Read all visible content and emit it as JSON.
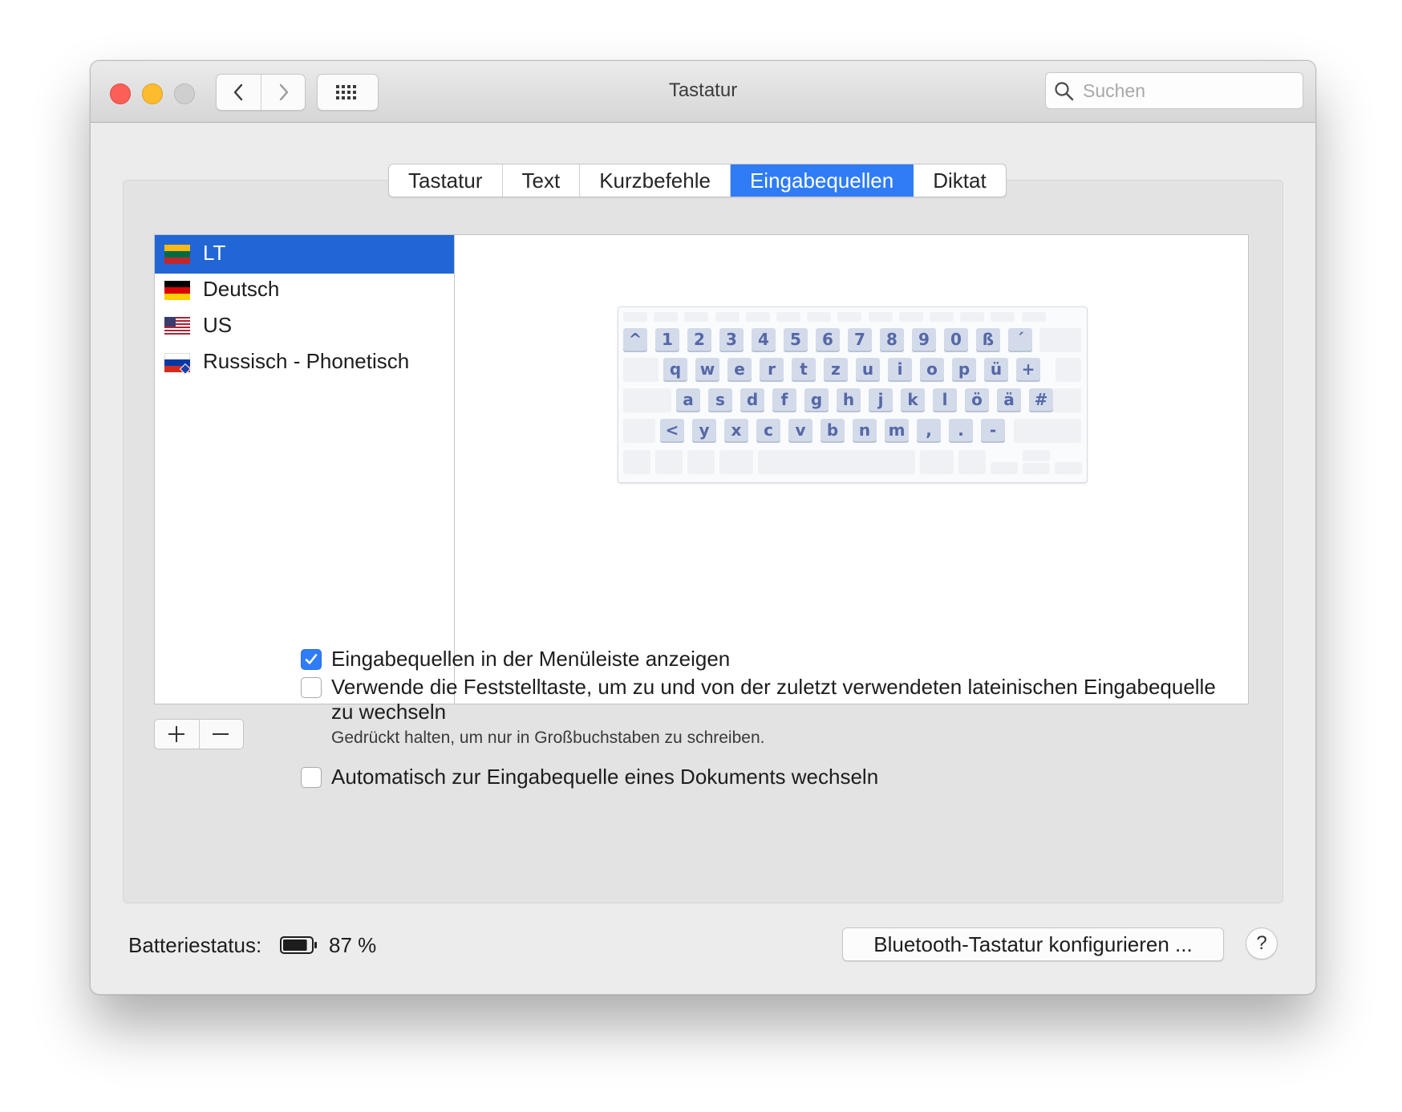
{
  "window": {
    "title": "Tastatur"
  },
  "search": {
    "placeholder": "Suchen"
  },
  "tabs": [
    "Tastatur",
    "Text",
    "Kurzbefehle",
    "Eingabequellen",
    "Diktat"
  ],
  "active_tab": "Eingabequellen",
  "input_sources": [
    {
      "label": "LT",
      "flag": "lithuania-flag-icon",
      "selected": true
    },
    {
      "label": "Deutsch",
      "flag": "germany-flag-icon",
      "selected": false
    },
    {
      "label": "US",
      "flag": "usa-flag-icon",
      "selected": false
    },
    {
      "label": "Russisch - Phonetisch",
      "flag": "russia-flag-icon",
      "selected": false
    }
  ],
  "keyboard_rows": [
    [
      "^",
      "1",
      "2",
      "3",
      "4",
      "5",
      "6",
      "7",
      "8",
      "9",
      "0",
      "ß",
      "´"
    ],
    [
      "q",
      "w",
      "e",
      "r",
      "t",
      "z",
      "u",
      "i",
      "o",
      "p",
      "ü",
      "+"
    ],
    [
      "a",
      "s",
      "d",
      "f",
      "g",
      "h",
      "j",
      "k",
      "l",
      "ö",
      "ä",
      "#"
    ],
    [
      "<",
      "y",
      "x",
      "c",
      "v",
      "b",
      "n",
      "m",
      ",",
      ".",
      "-"
    ]
  ],
  "options": {
    "show_in_menubar": {
      "label": "Eingabequellen in der Menüleiste anzeigen",
      "checked": true
    },
    "capslock": {
      "label_line1": "Verwende die Feststelltaste, um zu und von der zuletzt verwendeten lateinischen Eingabequelle",
      "label_line2": "zu wechseln",
      "hint": "Gedrückt halten, um nur in Großbuchstaben zu schreiben.",
      "checked": false
    },
    "auto_switch": {
      "label": "Automatisch zur Eingabequelle eines Dokuments wechseln",
      "checked": false
    }
  },
  "footer": {
    "battery_label": "Batteriestatus:",
    "battery_value": "87 %",
    "battery_level": 0.87,
    "bluetooth_button": "Bluetooth-Tastatur konfigurieren ...",
    "help": "?"
  },
  "colors": {
    "accent": "#2f7cf6",
    "selection": "#2266d6",
    "key_text": "#5568a6"
  }
}
